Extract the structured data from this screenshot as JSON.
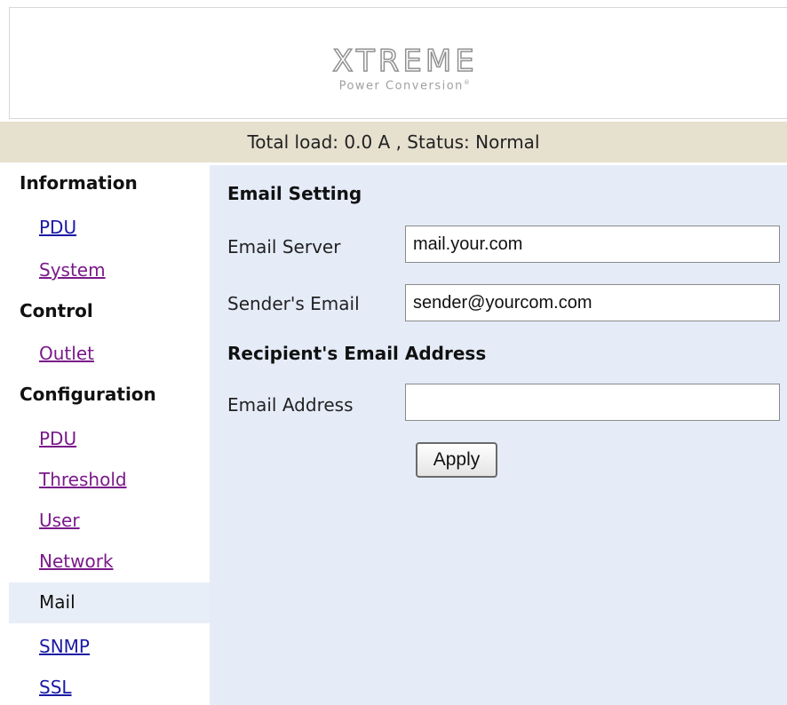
{
  "header": {
    "logo_main": "XTREME",
    "logo_sub": "Power Conversion",
    "logo_reg": "®"
  },
  "status_bar": {
    "text": "Total load: 0.0 A , Status: Normal"
  },
  "sidebar": {
    "sections": [
      {
        "title": "Information"
      },
      {
        "title": "Control"
      },
      {
        "title": "Configuration"
      }
    ],
    "links": {
      "info_pdu": "PDU",
      "info_system": "System",
      "control_outlet": "Outlet",
      "config_pdu": "PDU",
      "config_threshold": "Threshold",
      "config_user": "User",
      "config_network": "Network",
      "config_mail": "Mail",
      "config_snmp": "SNMP",
      "config_ssl": "SSL"
    }
  },
  "main": {
    "email_setting_title": "Email Setting",
    "email_server_label": "Email Server",
    "email_server_value": "mail.your.com",
    "sender_email_label": "Sender's Email",
    "sender_email_value": "sender@yourcom.com",
    "recipient_title": "Recipient's Email Address",
    "email_address_label": "Email Address",
    "email_address_value": "",
    "apply_label": "Apply"
  },
  "colors": {
    "status_bar_bg": "#e6e1cf",
    "main_bg": "#e5ecf8",
    "link": "#1a1aa6",
    "link_visited": "#7a1a8a"
  }
}
